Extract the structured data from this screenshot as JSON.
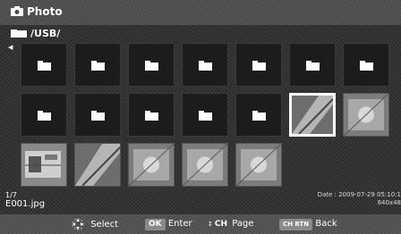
{
  "header": {
    "title": "Photo",
    "icon": "camera-icon"
  },
  "path": {
    "text": "/USB/",
    "icon": "folder-icon"
  },
  "status": {
    "counter": "1/7",
    "filename": "E001.jpg",
    "date": "Date : 2009-07-29 05:10:1",
    "resolution": "640x48"
  },
  "footer": {
    "select_label": "Select",
    "enter_key": "OK",
    "enter_label": "Enter",
    "page_key": "CH",
    "page_label": "Page",
    "back_key": "CH RTN",
    "back_label": "Back"
  },
  "grid": {
    "folder_count": 12,
    "photo_count": 7,
    "selected_index": 12
  }
}
